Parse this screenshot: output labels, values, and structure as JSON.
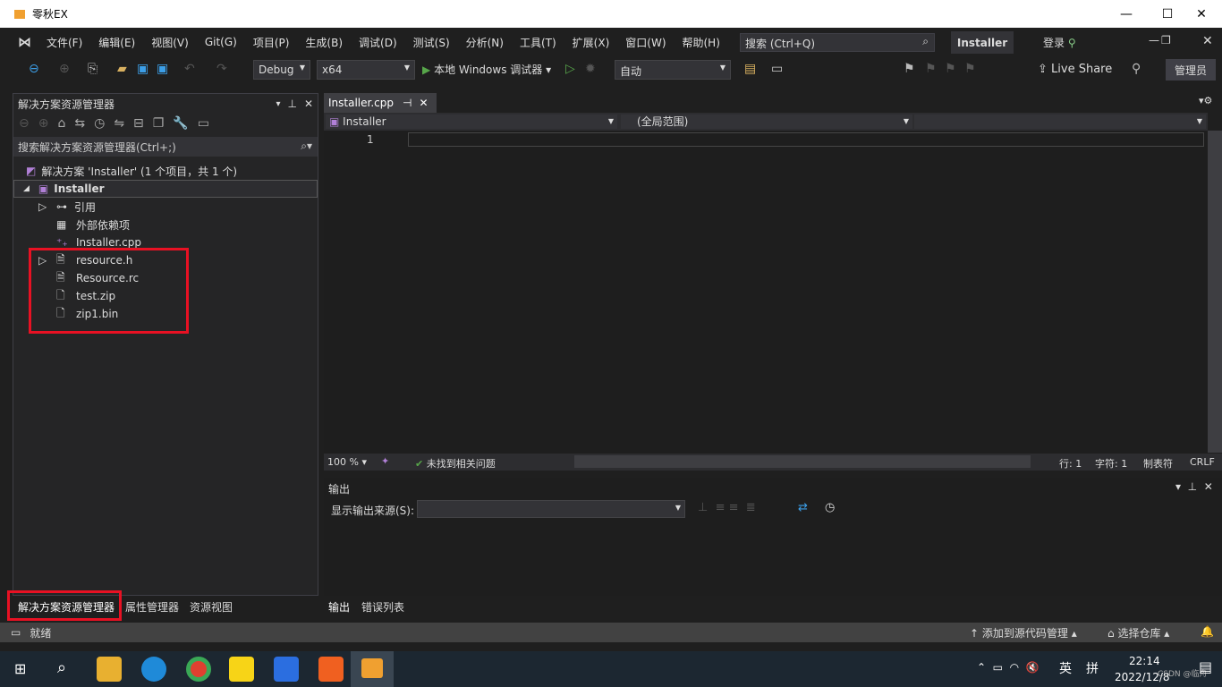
{
  "window": {
    "title": "零秋EX",
    "minimize": "—",
    "maximize": "☐",
    "close": "✕"
  },
  "menu": [
    "文件(F)",
    "编辑(E)",
    "视图(V)",
    "Git(G)",
    "项目(P)",
    "生成(B)",
    "调试(D)",
    "测试(S)",
    "分析(N)",
    "工具(T)",
    "扩展(X)",
    "窗口(W)",
    "帮助(H)"
  ],
  "search_placeholder": "搜索 (Ctrl+Q)",
  "project_badge": "Installer",
  "login": "登录",
  "toolbar": {
    "config": "Debug",
    "platform": "x64",
    "run_label": "本地 Windows 调试器",
    "auto": "自动",
    "live_share": "Live Share",
    "admin": "管理员"
  },
  "solution_explorer": {
    "title": "解决方案资源管理器",
    "search_placeholder": "搜索解决方案资源管理器(Ctrl+;)",
    "solution": "解决方案 'Installer' (1 个项目，共 1 个)",
    "project": "Installer",
    "items": [
      {
        "label": "引用",
        "icon": "references-icon",
        "expandable": true
      },
      {
        "label": "外部依赖项",
        "icon": "external-deps-icon",
        "expandable": false
      },
      {
        "label": "Installer.cpp",
        "icon": "cpp-file-icon",
        "expandable": false
      },
      {
        "label": "resource.h",
        "icon": "header-file-icon",
        "expandable": true
      },
      {
        "label": "Resource.rc",
        "icon": "resource-file-icon",
        "expandable": false
      },
      {
        "label": "test.zip",
        "icon": "file-icon",
        "expandable": false
      },
      {
        "label": "zip1.bin",
        "icon": "file-icon",
        "expandable": false
      }
    ],
    "bottom_tabs": [
      "解决方案资源管理器",
      "属性管理器",
      "资源视图"
    ]
  },
  "editor": {
    "tab": "Installer.cpp",
    "nav_project": "Installer",
    "nav_scope": "(全局范围)",
    "line_number": "1",
    "zoom": "100 %",
    "issues": "未找到相关问题",
    "line": "行: 1",
    "char": "字符: 1",
    "tabs_mode": "制表符",
    "eol": "CRLF"
  },
  "output": {
    "title": "输出",
    "source_label": "显示输出来源(S):",
    "tabs": [
      "输出",
      "错误列表"
    ]
  },
  "status": {
    "ready": "就绪",
    "add_source": "添加到源代码管理",
    "select_repo": "选择仓库"
  },
  "taskbar": {
    "ime_lang": "英",
    "ime_mode": "拼",
    "time": "22:14",
    "date": "2022/12/8",
    "watermark": "CSDN @临舟"
  },
  "colors": {
    "accent": "#007acc",
    "highlight_box": "#e81123",
    "run_green": "#57a64a"
  }
}
